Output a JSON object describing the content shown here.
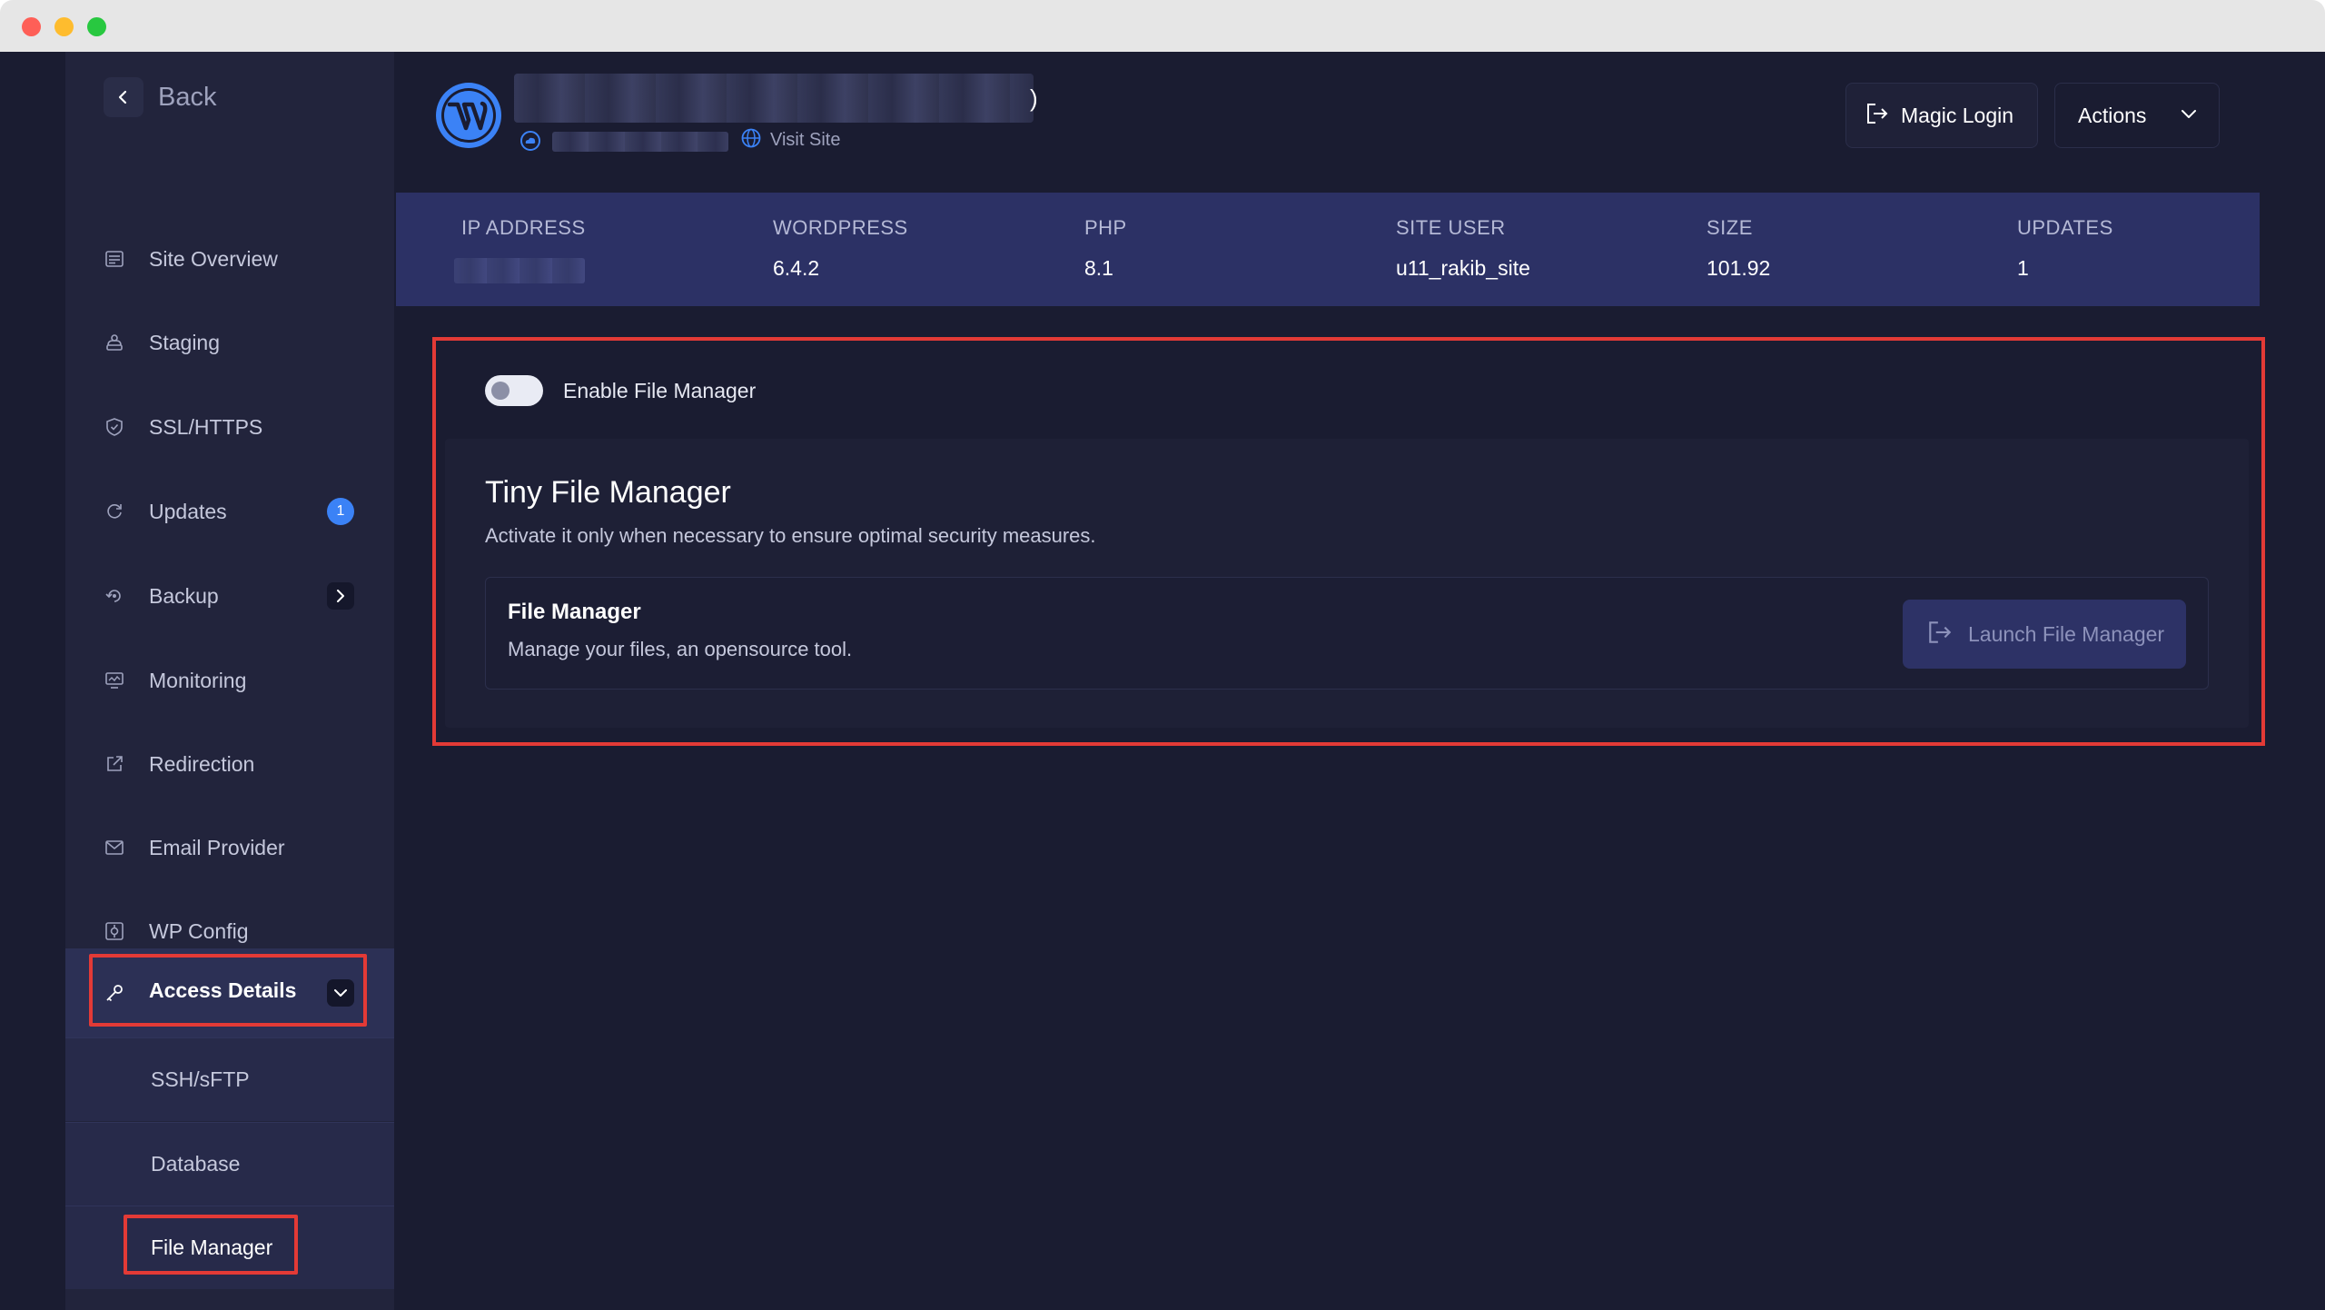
{
  "window": {
    "controls": [
      "close",
      "minimize",
      "zoom"
    ]
  },
  "sidebar": {
    "back_label": "Back",
    "items": [
      {
        "label": "Site Overview",
        "icon": "site-overview-icon"
      },
      {
        "label": "Staging",
        "icon": "staging-icon"
      },
      {
        "label": "SSL/HTTPS",
        "icon": "shield-icon"
      },
      {
        "label": "Updates",
        "icon": "updates-icon",
        "badge": "1"
      },
      {
        "label": "Backup",
        "icon": "backup-icon"
      },
      {
        "label": "Monitoring",
        "icon": "monitoring-icon"
      },
      {
        "label": "Redirection",
        "icon": "redirect-icon"
      },
      {
        "label": "Email Provider",
        "icon": "mail-icon"
      },
      {
        "label": "WP Config",
        "icon": "config-icon"
      }
    ],
    "access": {
      "label": "Access Details",
      "icon": "key-icon",
      "subitems": [
        {
          "label": "SSH/sFTP"
        },
        {
          "label": "Database"
        },
        {
          "label": "File Manager"
        }
      ]
    }
  },
  "header": {
    "visit_label": "Visit Site",
    "magic_login_label": "Magic Login",
    "actions_label": "Actions"
  },
  "stats": [
    {
      "label": "IP ADDRESS",
      "value": ""
    },
    {
      "label": "WORDPRESS",
      "value": "6.4.2"
    },
    {
      "label": "PHP",
      "value": "8.1"
    },
    {
      "label": "SITE USER",
      "value": "u11_rakib_site"
    },
    {
      "label": "SIZE",
      "value": "101.92"
    },
    {
      "label": "UPDATES",
      "value": "1"
    }
  ],
  "file_manager": {
    "toggle_label": "Enable File Manager",
    "toggle_enabled": false,
    "title": "Tiny File Manager",
    "description": "Activate it only when necessary to ensure optimal security measures.",
    "card_title": "File Manager",
    "card_description": "Manage your files, an opensource tool.",
    "launch_label": "Launch File Manager"
  },
  "colors": {
    "background": "#1a1c31",
    "sidebar": "#22243c",
    "stats_bar": "#2c3165",
    "highlight": "#e33a36",
    "accent": "#3b82f6"
  }
}
